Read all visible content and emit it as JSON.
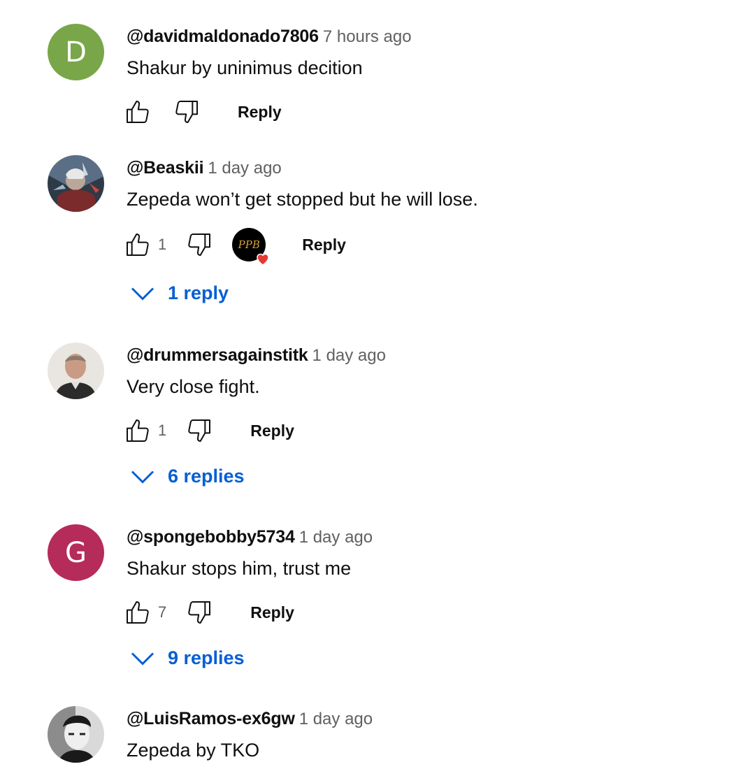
{
  "comments": [
    {
      "author": "@davidmaldonado7806",
      "time": "7 hours ago",
      "text": "Shakur by uninimus decition",
      "likes": "",
      "reply_label": "Reply",
      "avatar": {
        "type": "letter",
        "letter": "D",
        "color": "#79a649"
      }
    },
    {
      "author": "@Beaskii",
      "time": "1 day ago",
      "text": "Zepeda won’t get stopped but he will lose.",
      "likes": "1",
      "reply_label": "Reply",
      "avatar": {
        "type": "image",
        "description": "superhero-avatar"
      },
      "creator_heart": {
        "initials": "PPB"
      },
      "replies_label": "1 reply"
    },
    {
      "author": "@drummersagainstitk",
      "time": "1 day ago",
      "text": "Very close fight.",
      "likes": "1",
      "reply_label": "Reply",
      "avatar": {
        "type": "image",
        "description": "man-avatar"
      },
      "replies_label": "6 replies"
    },
    {
      "author": "@spongebobby5734",
      "time": "1 day ago",
      "text": "Shakur stops him, trust me",
      "likes": "7",
      "reply_label": "Reply",
      "avatar": {
        "type": "letter",
        "letter": "G",
        "color": "#b52b5a"
      },
      "replies_label": "9 replies"
    },
    {
      "author": "@LuisRamos-ex6gw",
      "time": "1 day ago",
      "text": "Zepeda by TKO",
      "avatar": {
        "type": "image",
        "description": "bw-face-avatar"
      }
    }
  ],
  "colors": {
    "link": "#065fd4",
    "meta": "#606060",
    "heart": "#e53935"
  }
}
